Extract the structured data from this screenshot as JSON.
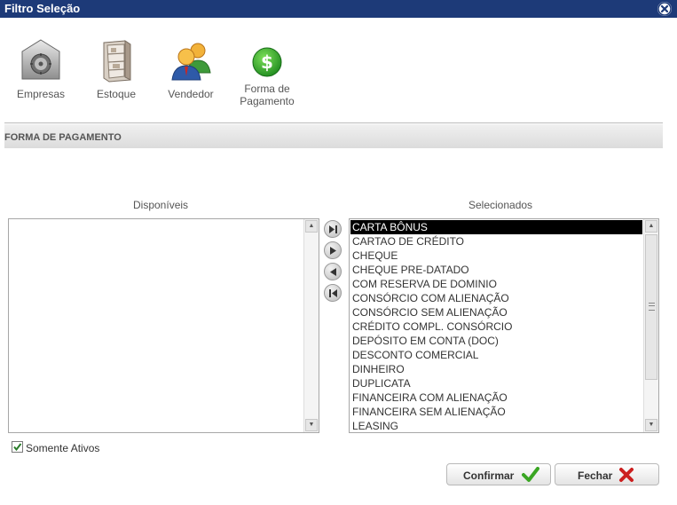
{
  "window": {
    "title": "Filtro Seleção"
  },
  "toolbar": [
    {
      "label": "Empresas",
      "icon": "safe-icon"
    },
    {
      "label": "Estoque",
      "icon": "shelf-icon"
    },
    {
      "label": "Vendedor",
      "icon": "users-icon"
    },
    {
      "label": "Forma de Pagamento",
      "line1": "Forma de",
      "line2": "Pagamento",
      "icon": "dollar-icon"
    }
  ],
  "section": {
    "title": "FORMA DE PAGAMENTO"
  },
  "lists": {
    "available": {
      "header": "Disponíveis",
      "items": []
    },
    "selected": {
      "header": "Selecionados",
      "items": [
        "CARTA BÔNUS",
        "CARTAO DE CRÉDITO",
        "CHEQUE",
        "CHEQUE PRE-DATADO",
        "COM RESERVA DE DOMINIO",
        "CONSÓRCIO COM ALIENAÇÃO",
        "CONSÓRCIO SEM ALIENAÇÃO",
        "CRÉDITO COMPL. CONSÓRCIO",
        "DEPÓSITO EM CONTA (DOC)",
        "DESCONTO COMERCIAL",
        "DINHEIRO",
        "DUPLICATA",
        "FINANCEIRA COM ALIENAÇÃO",
        "FINANCEIRA SEM ALIENAÇÃO",
        "LEASING"
      ],
      "selected_item": "CARTA BÔNUS"
    }
  },
  "transfer_buttons": [
    "move-all-right-icon",
    "move-right-icon",
    "move-left-icon",
    "move-all-left-icon"
  ],
  "filters": {
    "active_only_label": "Somente Ativos",
    "active_only_checked": true
  },
  "footer": {
    "confirm_label": "Confirmar",
    "close_label": "Fechar"
  },
  "colors": {
    "titlebar": "#1d3a78",
    "confirm_icon": "#3aa623",
    "close_icon": "#cc1f1f",
    "selection": "#000000"
  }
}
